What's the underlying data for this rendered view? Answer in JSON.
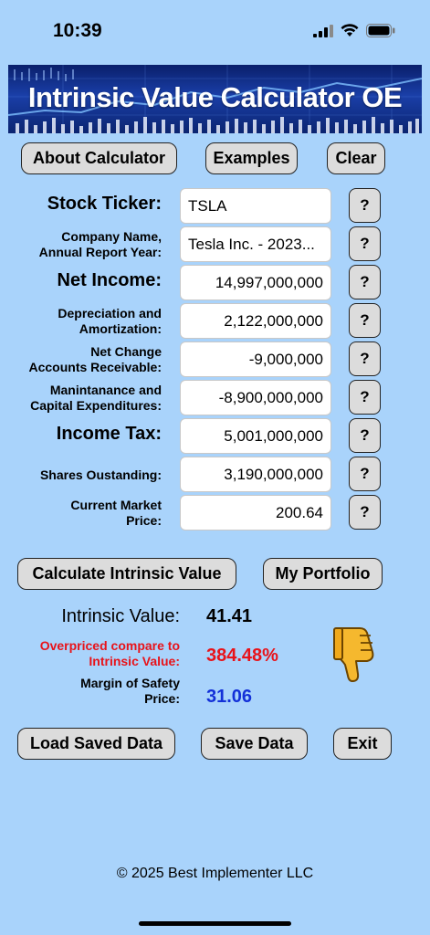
{
  "status": {
    "time": "10:39"
  },
  "banner": {
    "title": "Intrinsic Value Calculator OE"
  },
  "top_buttons": {
    "about": "About Calculator",
    "examples": "Examples",
    "clear": "Clear"
  },
  "fields": [
    {
      "label": "Stock Ticker:",
      "value": "TSLA"
    },
    {
      "label": "Company Name,\nAnnual Report Year:",
      "value": "Tesla Inc. - 2023..."
    },
    {
      "label": "Net Income:",
      "value": "14,997,000,000"
    },
    {
      "label": "Depreciation and\nAmortization:",
      "value": "2,122,000,000"
    },
    {
      "label": "Net Change\nAccounts Receivable:",
      "value": "-9,000,000"
    },
    {
      "label": "Manintanance and\nCapital Expenditures:",
      "value": "-8,900,000,000"
    },
    {
      "label": "Income Tax:",
      "value": "5,001,000,000"
    },
    {
      "label": "Shares Oustanding:",
      "value": "3,190,000,000"
    },
    {
      "label": "Current Market\nPrice:",
      "value": "200.64"
    }
  ],
  "help_label": "?",
  "actions": {
    "calculate": "Calculate Intrinsic Value",
    "portfolio": "My Portfolio"
  },
  "results": {
    "intrinsic_label": "Intrinsic Value:",
    "intrinsic_value": "41.41",
    "overpriced_label": "Overpriced compare to\nIntrinsic Value:",
    "overpriced_value": "384.48%",
    "margin_label": "Margin of Safety\nPrice:",
    "margin_value": "31.06"
  },
  "colors": {
    "overpriced": "#e8131a",
    "margin": "#1330d8",
    "background": "#a9d3fb"
  },
  "bottom_buttons": {
    "load": "Load Saved Data",
    "save": "Save Data",
    "exit": "Exit"
  },
  "footer": "© 2025 Best Implementer LLC",
  "icons": {
    "thumbs": "thumbs-down-icon"
  }
}
